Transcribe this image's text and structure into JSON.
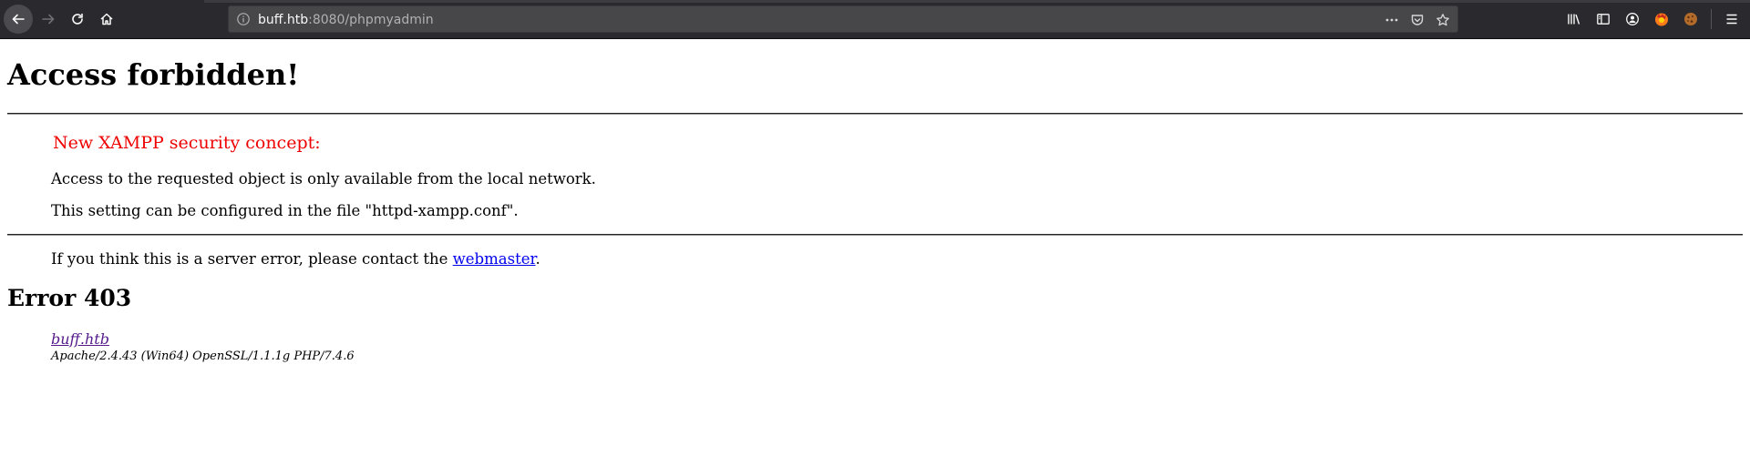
{
  "browser": {
    "url_host": "buff.htb",
    "url_rest": ":8080/phpmyadmin",
    "icons": [
      "back-arrow-icon",
      "forward-arrow-icon",
      "reload-icon",
      "home-icon",
      "info-icon",
      "more-icon",
      "pocket-icon",
      "star-icon",
      "library-icon",
      "sidebar-icon",
      "account-icon",
      "firefox-addon-icon",
      "cookie-addon-icon",
      "menu-icon"
    ]
  },
  "page": {
    "title": "Access forbidden!",
    "section_title": "New XAMPP security concept:",
    "paragraph1": "Access to the requested object is only available from the local network.",
    "paragraph2": "This setting can be configured in the file \"httpd-xampp.conf\".",
    "contact_prefix": "If you think this is a server error, please contact the ",
    "contact_link": "webmaster",
    "contact_suffix": ".",
    "error_heading": "Error 403",
    "server_link": "buff.htb",
    "server_signature": "Apache/2.4.43 (Win64) OpenSSL/1.1.1g PHP/7.4.6"
  },
  "colors": {
    "section_title": "#ee0000",
    "link": "#0000ee",
    "visited_link": "#551a8b",
    "toolbar": "#2a2a2e"
  }
}
